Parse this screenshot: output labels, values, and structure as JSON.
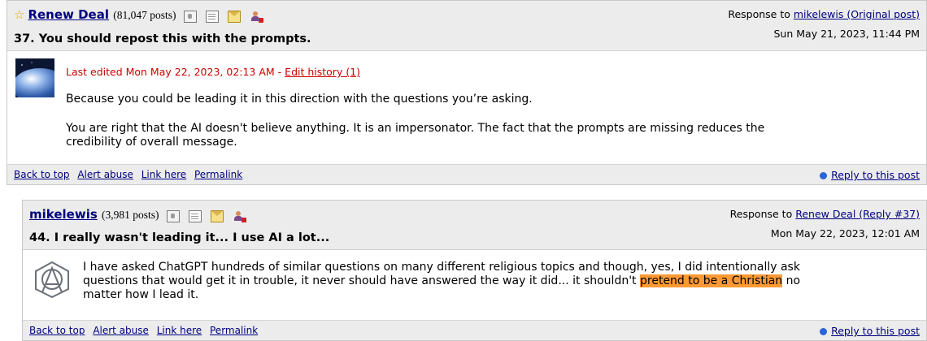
{
  "colors": {
    "header_bg": "#ececec",
    "link": "#000080",
    "edited": "#cc0000",
    "highlight": "#ff9933",
    "reply_dot": "#2a64d8"
  },
  "post1": {
    "author": "Renew Deal",
    "post_count": "(81,047 posts)",
    "subject": "37. You should repost this with the prompts.",
    "response_prefix": "Response to",
    "response_link": "mikelewis (Original post)",
    "date": "Sun May 21, 2023, 11:44 PM",
    "edited_text": "Last edited Mon May 22, 2023, 02:13 AM -",
    "edit_history": "Edit history (1)",
    "body": [
      "Because you could be leading it in this direction with the questions you’re asking.",
      "You are right that the AI doesn't believe anything. It is an impersonator. The fact that the prompts are missing reduces the credibility of overall message."
    ],
    "icons": [
      "star-icon",
      "profile-icon",
      "journal-icon",
      "mail-icon",
      "ignore-icon"
    ]
  },
  "post2": {
    "author": "mikelewis",
    "post_count": "(3,981 posts)",
    "subject": "44. I really wasn't leading it... I use AI a lot...",
    "response_prefix": "Response to",
    "response_link": "Renew Deal (Reply #37)",
    "date": "Mon May 22, 2023, 12:01 AM",
    "body_before": "I have asked ChatGPT hundreds of similar questions on many different religious topics and though, yes, I did intentionally ask questions that would get it in trouble, it never should have answered the way it did... it shouldn't ",
    "body_highlight": "pretend to be a Christian",
    "body_after": " no matter how I lead it.",
    "icons": [
      "profile-icon",
      "journal-icon",
      "mail-icon",
      "ignore-icon"
    ]
  },
  "footer": {
    "back_to_top": "Back to top",
    "alert_abuse": "Alert abuse",
    "link_here": "Link here",
    "permalink": "Permalink",
    "reply": "Reply to this post"
  }
}
